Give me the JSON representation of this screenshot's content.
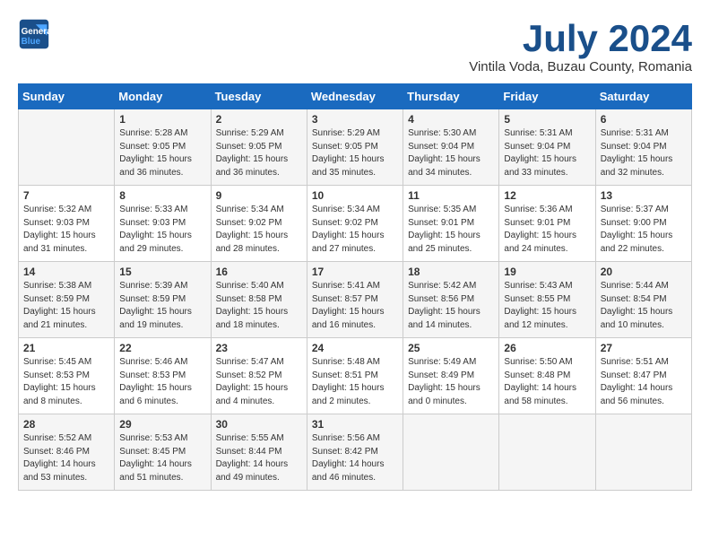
{
  "header": {
    "logo_line1": "General",
    "logo_line2": "Blue",
    "month": "July 2024",
    "location": "Vintila Voda, Buzau County, Romania"
  },
  "days_of_week": [
    "Sunday",
    "Monday",
    "Tuesday",
    "Wednesday",
    "Thursday",
    "Friday",
    "Saturday"
  ],
  "weeks": [
    [
      {
        "day": "",
        "info": ""
      },
      {
        "day": "1",
        "info": "Sunrise: 5:28 AM\nSunset: 9:05 PM\nDaylight: 15 hours\nand 36 minutes."
      },
      {
        "day": "2",
        "info": "Sunrise: 5:29 AM\nSunset: 9:05 PM\nDaylight: 15 hours\nand 36 minutes."
      },
      {
        "day": "3",
        "info": "Sunrise: 5:29 AM\nSunset: 9:05 PM\nDaylight: 15 hours\nand 35 minutes."
      },
      {
        "day": "4",
        "info": "Sunrise: 5:30 AM\nSunset: 9:04 PM\nDaylight: 15 hours\nand 34 minutes."
      },
      {
        "day": "5",
        "info": "Sunrise: 5:31 AM\nSunset: 9:04 PM\nDaylight: 15 hours\nand 33 minutes."
      },
      {
        "day": "6",
        "info": "Sunrise: 5:31 AM\nSunset: 9:04 PM\nDaylight: 15 hours\nand 32 minutes."
      }
    ],
    [
      {
        "day": "7",
        "info": "Sunrise: 5:32 AM\nSunset: 9:03 PM\nDaylight: 15 hours\nand 31 minutes."
      },
      {
        "day": "8",
        "info": "Sunrise: 5:33 AM\nSunset: 9:03 PM\nDaylight: 15 hours\nand 29 minutes."
      },
      {
        "day": "9",
        "info": "Sunrise: 5:34 AM\nSunset: 9:02 PM\nDaylight: 15 hours\nand 28 minutes."
      },
      {
        "day": "10",
        "info": "Sunrise: 5:34 AM\nSunset: 9:02 PM\nDaylight: 15 hours\nand 27 minutes."
      },
      {
        "day": "11",
        "info": "Sunrise: 5:35 AM\nSunset: 9:01 PM\nDaylight: 15 hours\nand 25 minutes."
      },
      {
        "day": "12",
        "info": "Sunrise: 5:36 AM\nSunset: 9:01 PM\nDaylight: 15 hours\nand 24 minutes."
      },
      {
        "day": "13",
        "info": "Sunrise: 5:37 AM\nSunset: 9:00 PM\nDaylight: 15 hours\nand 22 minutes."
      }
    ],
    [
      {
        "day": "14",
        "info": "Sunrise: 5:38 AM\nSunset: 8:59 PM\nDaylight: 15 hours\nand 21 minutes."
      },
      {
        "day": "15",
        "info": "Sunrise: 5:39 AM\nSunset: 8:59 PM\nDaylight: 15 hours\nand 19 minutes."
      },
      {
        "day": "16",
        "info": "Sunrise: 5:40 AM\nSunset: 8:58 PM\nDaylight: 15 hours\nand 18 minutes."
      },
      {
        "day": "17",
        "info": "Sunrise: 5:41 AM\nSunset: 8:57 PM\nDaylight: 15 hours\nand 16 minutes."
      },
      {
        "day": "18",
        "info": "Sunrise: 5:42 AM\nSunset: 8:56 PM\nDaylight: 15 hours\nand 14 minutes."
      },
      {
        "day": "19",
        "info": "Sunrise: 5:43 AM\nSunset: 8:55 PM\nDaylight: 15 hours\nand 12 minutes."
      },
      {
        "day": "20",
        "info": "Sunrise: 5:44 AM\nSunset: 8:54 PM\nDaylight: 15 hours\nand 10 minutes."
      }
    ],
    [
      {
        "day": "21",
        "info": "Sunrise: 5:45 AM\nSunset: 8:53 PM\nDaylight: 15 hours\nand 8 minutes."
      },
      {
        "day": "22",
        "info": "Sunrise: 5:46 AM\nSunset: 8:53 PM\nDaylight: 15 hours\nand 6 minutes."
      },
      {
        "day": "23",
        "info": "Sunrise: 5:47 AM\nSunset: 8:52 PM\nDaylight: 15 hours\nand 4 minutes."
      },
      {
        "day": "24",
        "info": "Sunrise: 5:48 AM\nSunset: 8:51 PM\nDaylight: 15 hours\nand 2 minutes."
      },
      {
        "day": "25",
        "info": "Sunrise: 5:49 AM\nSunset: 8:49 PM\nDaylight: 15 hours\nand 0 minutes."
      },
      {
        "day": "26",
        "info": "Sunrise: 5:50 AM\nSunset: 8:48 PM\nDaylight: 14 hours\nand 58 minutes."
      },
      {
        "day": "27",
        "info": "Sunrise: 5:51 AM\nSunset: 8:47 PM\nDaylight: 14 hours\nand 56 minutes."
      }
    ],
    [
      {
        "day": "28",
        "info": "Sunrise: 5:52 AM\nSunset: 8:46 PM\nDaylight: 14 hours\nand 53 minutes."
      },
      {
        "day": "29",
        "info": "Sunrise: 5:53 AM\nSunset: 8:45 PM\nDaylight: 14 hours\nand 51 minutes."
      },
      {
        "day": "30",
        "info": "Sunrise: 5:55 AM\nSunset: 8:44 PM\nDaylight: 14 hours\nand 49 minutes."
      },
      {
        "day": "31",
        "info": "Sunrise: 5:56 AM\nSunset: 8:42 PM\nDaylight: 14 hours\nand 46 minutes."
      },
      {
        "day": "",
        "info": ""
      },
      {
        "day": "",
        "info": ""
      },
      {
        "day": "",
        "info": ""
      }
    ]
  ]
}
